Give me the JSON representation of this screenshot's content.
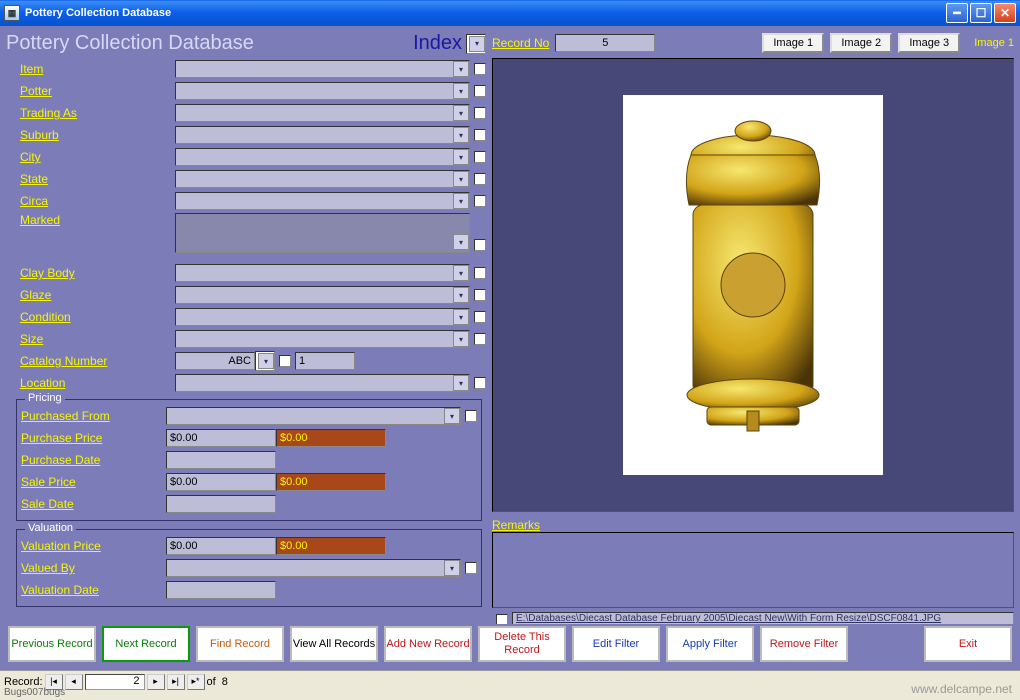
{
  "window": {
    "title": "Pottery Collection Database"
  },
  "header": {
    "title": "Pottery Collection Database",
    "index_label": "Index"
  },
  "fields1": [
    {
      "label": "Item"
    },
    {
      "label": "Potter"
    },
    {
      "label": "Trading As"
    },
    {
      "label": "Suburb"
    },
    {
      "label": "City"
    },
    {
      "label": "State"
    },
    {
      "label": "Circa"
    },
    {
      "label": "Marked"
    }
  ],
  "fields2": [
    {
      "label": "Clay Body"
    },
    {
      "label": "Glaze"
    },
    {
      "label": "Condition"
    },
    {
      "label": "Size"
    }
  ],
  "catalog": {
    "label": "Catalog Number",
    "prefix": "ABC",
    "number": "1"
  },
  "location_label": "Location",
  "pricing": {
    "group": "Pricing",
    "purchased_from": "Purchased From",
    "purchase_price": "Purchase Price",
    "purchase_date": "Purchase Date",
    "sale_price": "Sale Price",
    "sale_date": "Sale Date",
    "zero": "$0.00"
  },
  "valuation": {
    "group": "Valuation",
    "valuation_price": "Valuation Price",
    "valued_by": "Valued By",
    "valuation_date": "Valuation Date",
    "zero": "$0.00"
  },
  "right": {
    "record_label": "Record No",
    "record_no": "5",
    "img1": "Image 1",
    "img2": "Image 2",
    "img3": "Image 3",
    "current_image": "Image 1",
    "remarks_label": "Remarks",
    "path": "E:\\Databases\\Diecast Database February 2005\\Diecast New\\With Form Resize\\DSCF0841.JPG"
  },
  "toolbar": {
    "prev": "Previous Record",
    "next": "Next Record",
    "find": "Find Record",
    "viewall": "View All Records",
    "add": "Add New Record",
    "delete": "Delete This Record",
    "editf": "Edit Filter",
    "applyf": "Apply Filter",
    "removef": "Remove Filter",
    "exit": "Exit"
  },
  "status": {
    "record_label": "Record:",
    "current": "2",
    "of": "of",
    "total": "8"
  },
  "credit": "Bugs007bugs",
  "watermark": "www.delcampe.net"
}
